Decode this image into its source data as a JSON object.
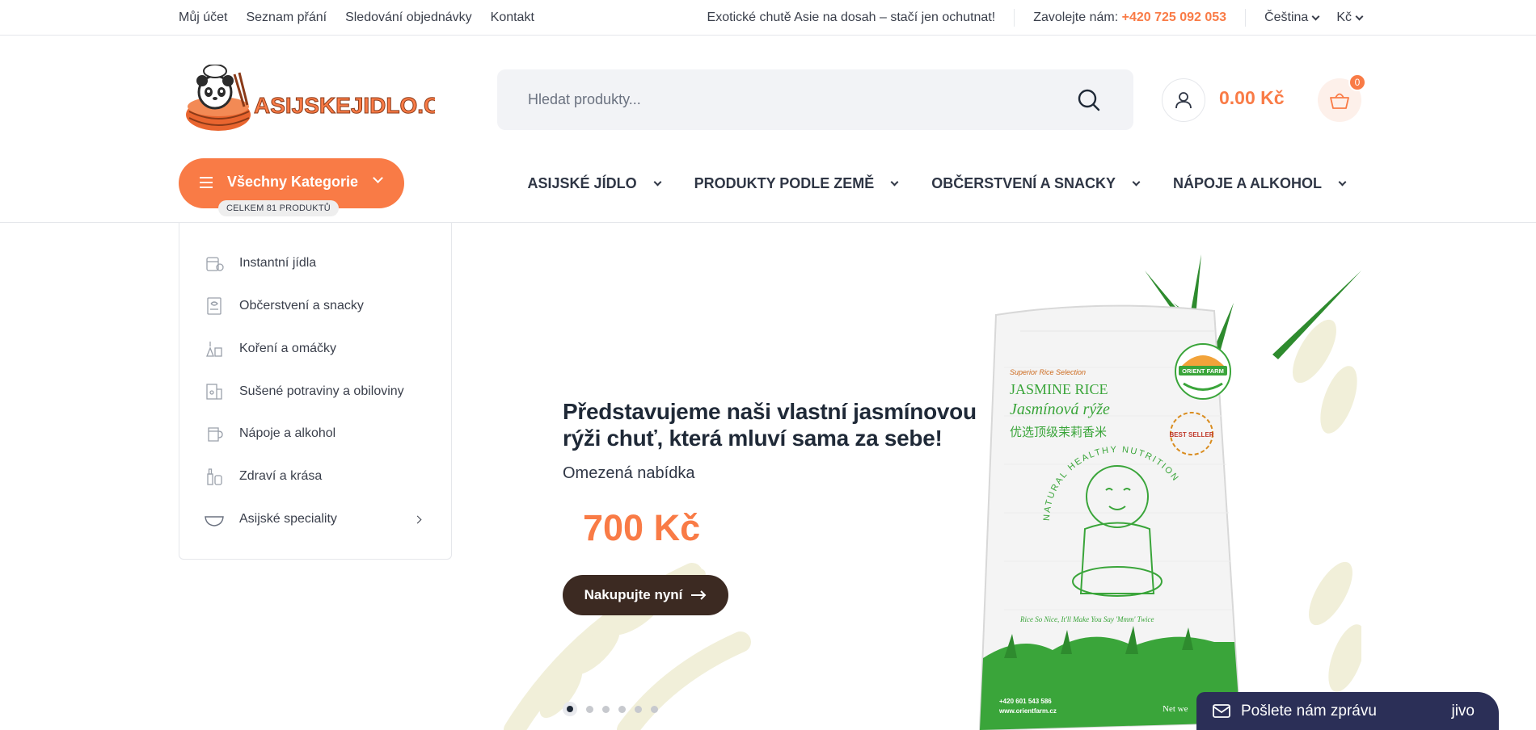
{
  "topbar": {
    "links": [
      "Můj účet",
      "Seznam přání",
      "Sledování objednávky",
      "Kontakt"
    ],
    "promo": "Exotické chutě Asie na dosah – stačí jen ochutnat!",
    "call_label": "Zavolejte nám:",
    "phone": "+420 725 092 053",
    "language": "Čeština",
    "currency": "Kč"
  },
  "header": {
    "logo_text": "ASIJSKEJIDLO.CZ",
    "search_placeholder": "Hledat produkty...",
    "cart_total": "0.00 Kč",
    "cart_count": "0"
  },
  "nav": {
    "all_categories": "Všechny Kategorie",
    "product_count": "CELKEM 81 PRODUKTŮ",
    "items": [
      "ASIJSKÉ JÍDLO",
      "PRODUKTY PODLE ZEMĚ",
      "OBČERSTVENÍ A SNACKY",
      "NÁPOJE A ALKOHOL"
    ]
  },
  "sidebar": {
    "items": [
      {
        "label": "Instantní jídla",
        "icon": "noodles-icon"
      },
      {
        "label": "Občerstvení a snacky",
        "icon": "snack-icon"
      },
      {
        "label": "Koření a omáčky",
        "icon": "spices-icon"
      },
      {
        "label": "Sušené potraviny a obiloviny",
        "icon": "grains-icon"
      },
      {
        "label": "Nápoje a alkohol",
        "icon": "drink-icon"
      },
      {
        "label": "Zdraví a krása",
        "icon": "beauty-icon"
      },
      {
        "label": "Asijské speciality",
        "icon": "bowl-icon"
      }
    ]
  },
  "hero": {
    "title": "Představujeme naši vlastní jasmínovou rýži chuť, která mluví sama za sebe!",
    "subtitle": "Omezená nabídka",
    "price": "700 Kč",
    "button": "Nakupujte nyní",
    "slide_count": 6,
    "active_slide": 1,
    "bag": {
      "tagline": "Superior Rice Selection",
      "title_en": "JASMINE RICE",
      "title_cz": "Jasmínová rýže",
      "title_cn": "优选顶级茉莉香米",
      "brand": "ORIENT FARM",
      "badge": "BEST SELLER",
      "ring": "NATURAL  HEALTHY  NUTRITION",
      "slogan": "Rice So Nice, It'll Make You Say 'Mmm' Twice",
      "phone": "+420 601 543 586",
      "web": "www.orientfarm.cz",
      "weight": "Net we"
    }
  },
  "chat": {
    "label": "Pošlete nám zprávu",
    "brand": "jivo"
  },
  "colors": {
    "accent": "#f97b46",
    "dark_button": "#3c2a22",
    "chat_bg": "#2b2f57",
    "bag_green": "#3aa53a"
  }
}
